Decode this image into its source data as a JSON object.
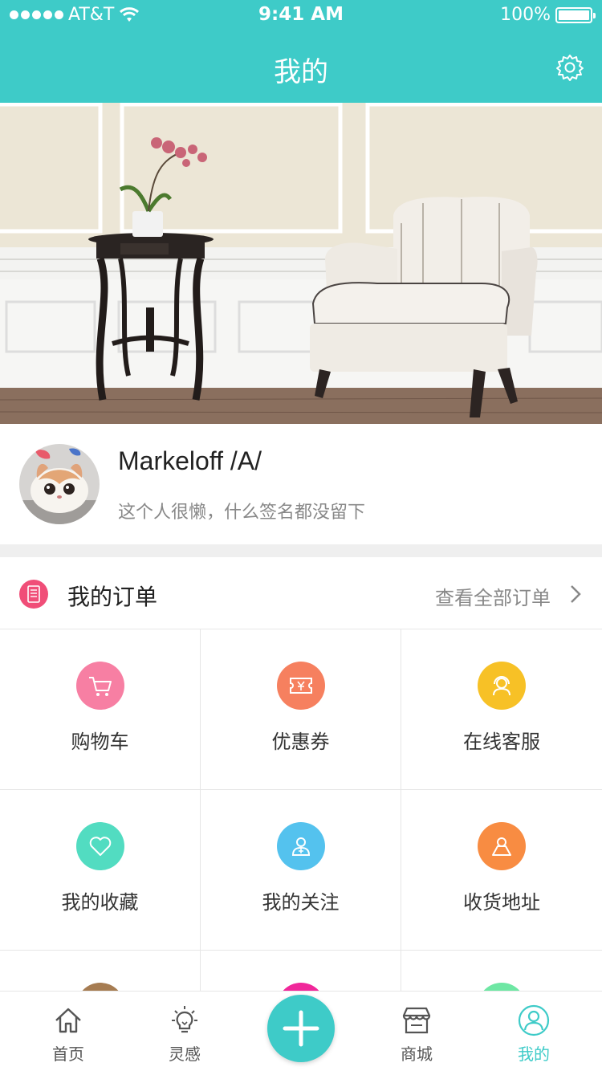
{
  "status_bar": {
    "carrier": "AT&T",
    "time": "9:41 AM",
    "battery": "100%"
  },
  "nav": {
    "title": "我的",
    "settings_icon": "gear-icon"
  },
  "profile": {
    "username": "Markeloff /A/",
    "signature": "这个人很懒，什么签名都没留下"
  },
  "orders": {
    "title": "我的订单",
    "view_all": "查看全部订单"
  },
  "grid": [
    {
      "label": "购物车",
      "icon": "shopping-cart-icon",
      "color": "#f77fa3"
    },
    {
      "label": "优惠券",
      "icon": "coupon-icon",
      "color": "#f6805f"
    },
    {
      "label": "在线客服",
      "icon": "customer-service-icon",
      "color": "#f7c126"
    },
    {
      "label": "我的收藏",
      "icon": "heart-icon",
      "color": "#52dcc1"
    },
    {
      "label": "我的关注",
      "icon": "follow-user-icon",
      "color": "#54c2ee"
    },
    {
      "label": "收货地址",
      "icon": "address-icon",
      "color": "#f88c42"
    },
    {
      "label": "",
      "icon": "more-icon",
      "color": "#a67c52"
    },
    {
      "label": "",
      "icon": "more-icon",
      "color": "#f0279a"
    },
    {
      "label": "",
      "icon": "more-icon",
      "color": "#6ee7a4"
    }
  ],
  "tabbar": {
    "tabs": [
      {
        "label": "首页",
        "icon": "home-icon"
      },
      {
        "label": "灵感",
        "icon": "lightbulb-icon"
      },
      {
        "label": "商城",
        "icon": "store-icon"
      },
      {
        "label": "我的",
        "icon": "user-icon"
      }
    ],
    "active": "我的",
    "accent": "#3ecbc8"
  }
}
